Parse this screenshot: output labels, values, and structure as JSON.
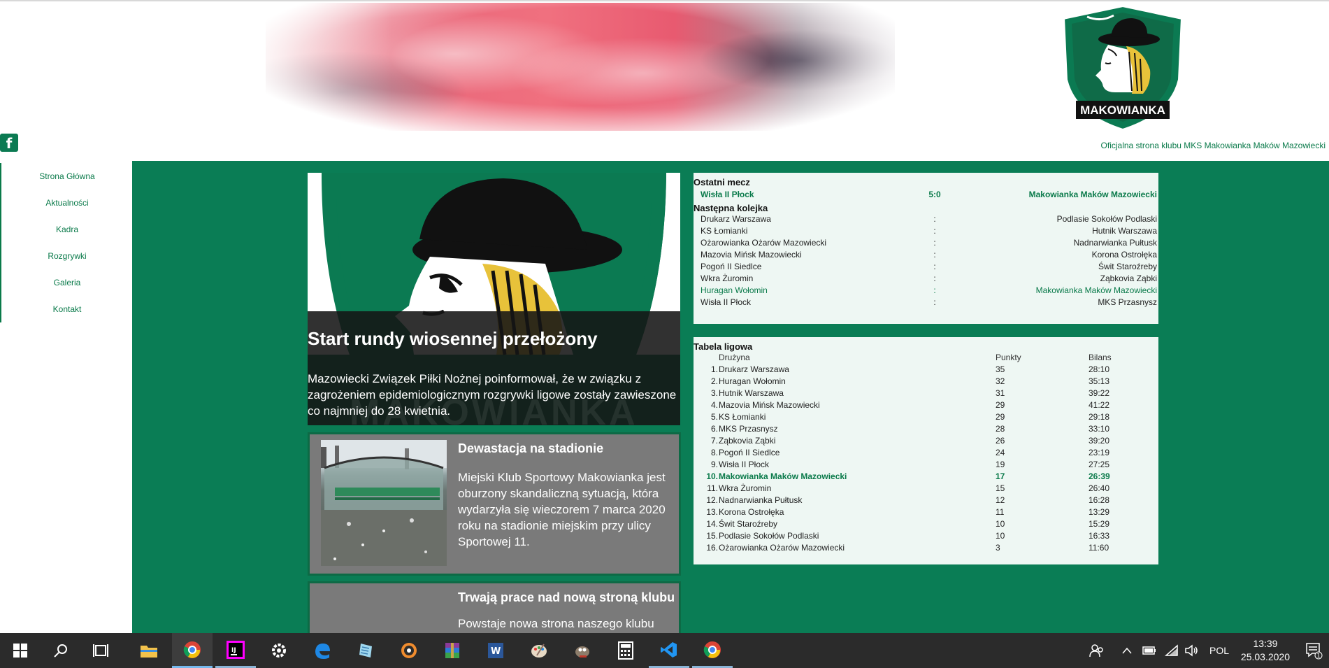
{
  "header": {
    "tagline": "Oficjalna strona klubu MKS Makowianka Maków Mazowiecki",
    "logo_text": "MAKOWIANKA",
    "facebook_icon": "facebook-icon"
  },
  "nav": [
    {
      "label": "Strona Główna"
    },
    {
      "label": "Aktualności"
    },
    {
      "label": "Kadra"
    },
    {
      "label": "Rozgrywki"
    },
    {
      "label": "Galeria"
    },
    {
      "label": "Kontakt"
    }
  ],
  "featured": {
    "title": "Start rundy wiosennej przełożony",
    "text": "Mazowiecki Związek Piłki Nożnej poinformował, że w związku z zagrożeniem epidemiologicznym rozgrywki ligowe zostały zawieszone co najmniej do 28 kwietnia.",
    "watermark": "MAKOWIANKA"
  },
  "news": [
    {
      "title": "Dewastacja na stadionie",
      "text": "Miejski Klub Sportowy Makowianka jest oburzony skandaliczną sytuacją, która wydarzyła się wieczorem 7 marca 2020 roku na stadionie miejskim przy ulicy Sportowej 11."
    },
    {
      "title": "Trwają prace nad nową stroną klubu",
      "text": "Powstaje nowa strona naszego klubu"
    }
  ],
  "last_match": {
    "heading": "Ostatni mecz",
    "home": "Wisła II Płock",
    "score": "5:0",
    "away": "Makowianka Maków Mazowiecki"
  },
  "next_round": {
    "heading": "Następna kolejka",
    "matches": [
      {
        "home": "Drukarz Warszawa",
        "sep": ":",
        "away": "Podlasie Sokołów Podlaski",
        "highlight": false
      },
      {
        "home": "KS Łomianki",
        "sep": ":",
        "away": "Hutnik Warszawa",
        "highlight": false
      },
      {
        "home": "Ożarowianka Ożarów Mazowiecki",
        "sep": ":",
        "away": "Nadnarwianka Pułtusk",
        "highlight": false
      },
      {
        "home": "Mazovia Mińsk Mazowiecki",
        "sep": ":",
        "away": "Korona Ostrołęka",
        "highlight": false
      },
      {
        "home": "Pogoń II Siedlce",
        "sep": ":",
        "away": "Świt Staroźreby",
        "highlight": false
      },
      {
        "home": "Wkra Żuromin",
        "sep": ":",
        "away": "Ząbkovia Ząbki",
        "highlight": false
      },
      {
        "home": "Huragan Wołomin",
        "sep": ":",
        "away": "Makowianka Maków Mazowiecki",
        "highlight": true
      },
      {
        "home": "Wisła II Płock",
        "sep": ":",
        "away": "MKS Przasnysz",
        "highlight": false
      }
    ]
  },
  "league_table": {
    "heading": "Tabela ligowa",
    "columns": [
      "Drużyna",
      "Punkty",
      "Bilans"
    ],
    "rows": [
      {
        "pos": "1.",
        "team": "Drukarz Warszawa",
        "pts": "35",
        "bal": "28:10",
        "highlight": false
      },
      {
        "pos": "2.",
        "team": "Huragan Wołomin",
        "pts": "32",
        "bal": "35:13",
        "highlight": false
      },
      {
        "pos": "3.",
        "team": "Hutnik Warszawa",
        "pts": "31",
        "bal": "39:22",
        "highlight": false
      },
      {
        "pos": "4.",
        "team": "Mazovia Mińsk Mazowiecki",
        "pts": "29",
        "bal": "41:22",
        "highlight": false
      },
      {
        "pos": "5.",
        "team": "KS Łomianki",
        "pts": "29",
        "bal": "29:18",
        "highlight": false
      },
      {
        "pos": "6.",
        "team": "MKS Przasnysz",
        "pts": "28",
        "bal": "33:10",
        "highlight": false
      },
      {
        "pos": "7.",
        "team": "Ząbkovia Ząbki",
        "pts": "26",
        "bal": "39:20",
        "highlight": false
      },
      {
        "pos": "8.",
        "team": "Pogoń II Siedlce",
        "pts": "24",
        "bal": "23:19",
        "highlight": false
      },
      {
        "pos": "9.",
        "team": "Wisła II Płock",
        "pts": "19",
        "bal": "27:25",
        "highlight": false
      },
      {
        "pos": "10.",
        "team": "Makowianka Maków Mazowiecki",
        "pts": "17",
        "bal": "26:39",
        "highlight": true
      },
      {
        "pos": "11.",
        "team": "Wkra Żuromin",
        "pts": "15",
        "bal": "26:40",
        "highlight": false
      },
      {
        "pos": "12.",
        "team": "Nadnarwianka Pułtusk",
        "pts": "12",
        "bal": "16:28",
        "highlight": false
      },
      {
        "pos": "13.",
        "team": "Korona Ostrołęka",
        "pts": "11",
        "bal": "13:29",
        "highlight": false
      },
      {
        "pos": "14.",
        "team": "Świt Staroźreby",
        "pts": "10",
        "bal": "15:29",
        "highlight": false
      },
      {
        "pos": "15.",
        "team": "Podlasie Sokołów Podlaski",
        "pts": "10",
        "bal": "16:33",
        "highlight": false
      },
      {
        "pos": "16.",
        "team": "Ożarowianka Ożarów Mazowiecki",
        "pts": "3",
        "bal": "11:60",
        "highlight": false
      }
    ]
  },
  "taskbar": {
    "apps": [
      "windows-start-icon",
      "search-icon",
      "task-view-icon",
      "file-explorer-icon",
      "chrome-icon",
      "intellij-icon",
      "settings-icon",
      "edge-icon",
      "notepad-icon",
      "media-player-icon",
      "winrar-icon",
      "word-icon",
      "paint-icon",
      "gimp-icon",
      "calculator-icon",
      "vscode-icon",
      "chrome-icon"
    ],
    "language": "POL",
    "time": "13:39",
    "date": "25.03.2020",
    "notification_count": "1"
  },
  "colors": {
    "brand_green": "#0a7d55",
    "link_green": "#0a7a4a",
    "card_gray": "#7a7a7a",
    "panel_bg": "#eef7f3",
    "taskbar_bg": "#2b2b2b"
  }
}
